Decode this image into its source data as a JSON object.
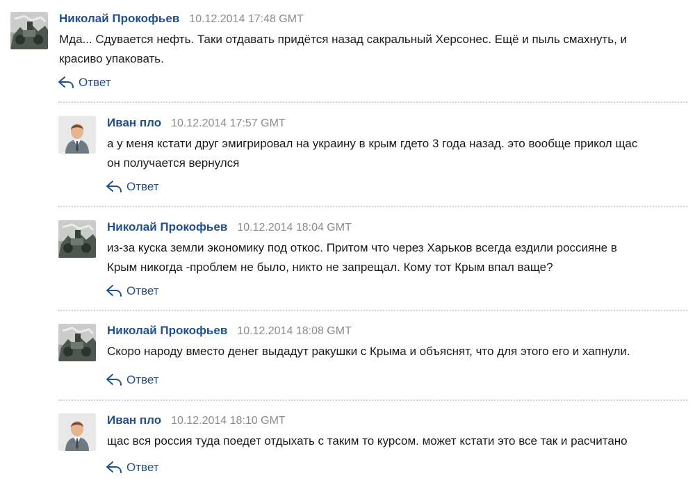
{
  "reply_label": "Ответ",
  "icons": {
    "reply": "reply-arrow-icon",
    "avatar_photo": "avatar-photo",
    "avatar_default": "avatar-default-user-icon"
  },
  "colors": {
    "author": "#1f4f8f",
    "date": "#8a8a8a",
    "text": "#1a1a1a",
    "separator": "#cfcfcf"
  },
  "comments": [
    {
      "author": "Николай Прокофьев",
      "date": "10.12.2014 17:48 GMT",
      "text": "Мда... Сдувается нефть. Таки отдавать придётся назад сакральный Херсонес. Ещё и пыль смахнуть, и\nкрасиво упаковать.",
      "avatar": "avatar-photo"
    },
    {
      "author": "Иван пло",
      "date": "10.12.2014 17:57 GMT",
      "text": "а у меня кстати друг эмигрировал на украину в крым гдето 3 года назад. это вообще прикол щас\nон получается вернулся",
      "avatar": "avatar-default-user-icon"
    },
    {
      "author": "Николай Прокофьев",
      "date": "10.12.2014 18:04 GMT",
      "text": "из-за куска земли экономику под откос. Притом что через Харьков всегда ездили россияне в\nКрым никогда -проблем не было, никто не запрещал. Кому тот Крым впал ваще?",
      "avatar": "avatar-photo"
    },
    {
      "author": "Николай Прокофьев",
      "date": "10.12.2014 18:08 GMT",
      "text": "Скоро народу вместо денег выдадут ракушки с Крыма и объяснят, что для этого его и хапнули.",
      "avatar": "avatar-photo"
    },
    {
      "author": "Иван пло",
      "date": "10.12.2014 18:10 GMT",
      "text": "щас вся россия туда поедет отдыхать с таким то курсом. может кстати это все так и расчитано",
      "avatar": "avatar-default-user-icon"
    }
  ]
}
